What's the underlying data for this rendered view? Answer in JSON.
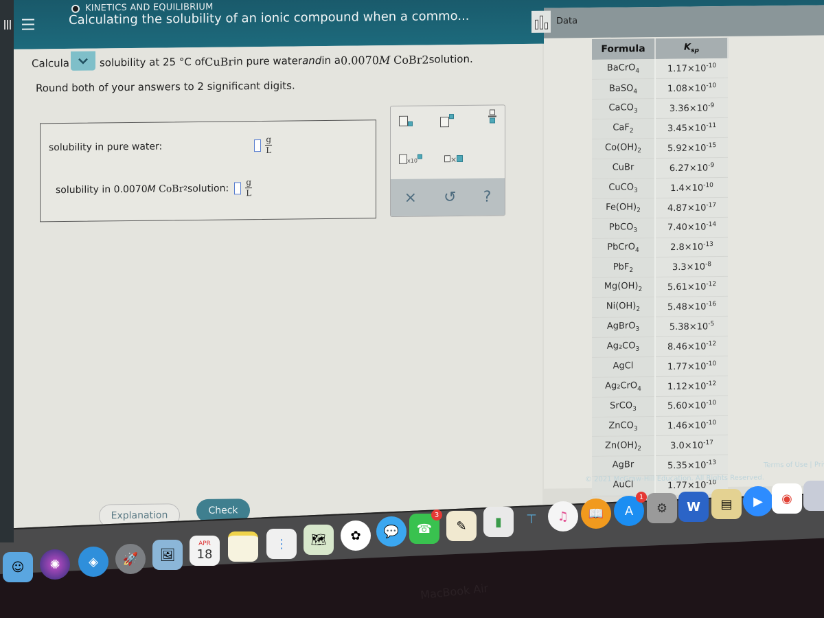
{
  "header": {
    "topic": "KINETICS AND EQUILIBRIUM",
    "title": "Calculating the solubility of an ionic compound when a commo..."
  },
  "question": {
    "prefix": "Calcula",
    "text_part1": "solubility at 25 °C of ",
    "compound": "CuBr",
    "text_part2": " in pure water ",
    "and_word": "and",
    "text_part3": " in a ",
    "concentration": "0.0070",
    "unit": "M",
    "solute": "CoBr",
    "solute_sub": "2",
    "text_part4": " solution.",
    "instruction": "Round both of your answers to 2 significant digits."
  },
  "answers": [
    {
      "label": "solubility in pure water:",
      "value": "",
      "unit_num": "g",
      "unit_den": "L"
    },
    {
      "label_pre": "solubility in 0.0070 ",
      "label_unit": "M",
      "label_solute": "CoBr",
      "label_sub": "2",
      "label_post": " solution:",
      "value": "",
      "unit_num": "g",
      "unit_den": "L"
    }
  ],
  "palette": {
    "buttons": [
      "subscript",
      "superscript",
      "fraction",
      "scientific-notation",
      "multiplication"
    ],
    "x10_label": "x10",
    "times_label": "×",
    "actions": {
      "clear": "×",
      "undo": "↺",
      "help": "?"
    }
  },
  "buttons": {
    "explanation": "Explanation",
    "check": "Check"
  },
  "data_panel": {
    "label": "Data",
    "headers": {
      "formula": "Formula",
      "ksp": "K",
      "ksp_sub": "sp"
    },
    "rows": [
      {
        "f": "BaCrO",
        "fs": "4",
        "m": "1.17",
        "e": "-10"
      },
      {
        "f": "BaSO",
        "fs": "4",
        "m": "1.08",
        "e": "-10"
      },
      {
        "f": "CaCO",
        "fs": "3",
        "m": "3.36",
        "e": "-9"
      },
      {
        "f": "CaF",
        "fs": "2",
        "m": "3.45",
        "e": "-11"
      },
      {
        "f": "Co(OH)",
        "fs": "2",
        "m": "5.92",
        "e": "-15"
      },
      {
        "f": "CuBr",
        "fs": "",
        "m": "6.27",
        "e": "-9"
      },
      {
        "f": "CuCO",
        "fs": "3",
        "m": "1.4",
        "e": "-10"
      },
      {
        "f": "Fe(OH)",
        "fs": "2",
        "m": "4.87",
        "e": "-17"
      },
      {
        "f": "PbCO",
        "fs": "3",
        "m": "7.40",
        "e": "-14"
      },
      {
        "f": "PbCrO",
        "fs": "4",
        "m": "2.8",
        "e": "-13"
      },
      {
        "f": "PbF",
        "fs": "2",
        "m": "3.3",
        "e": "-8"
      },
      {
        "f": "Mg(OH)",
        "fs": "2",
        "m": "5.61",
        "e": "-12"
      },
      {
        "f": "Ni(OH)",
        "fs": "2",
        "m": "5.48",
        "e": "-16"
      },
      {
        "f": "AgBrO",
        "fs": "3",
        "m": "5.38",
        "e": "-5"
      },
      {
        "f": "Ag₂CO",
        "fs": "3",
        "m": "8.46",
        "e": "-12"
      },
      {
        "f": "AgCl",
        "fs": "",
        "m": "1.77",
        "e": "-10"
      },
      {
        "f": "Ag₂CrO",
        "fs": "4",
        "m": "1.12",
        "e": "-12"
      },
      {
        "f": "SrCO",
        "fs": "3",
        "m": "5.60",
        "e": "-10"
      },
      {
        "f": "ZnCO",
        "fs": "3",
        "m": "1.46",
        "e": "-10"
      },
      {
        "f": "Zn(OH)",
        "fs": "2",
        "m": "3.0",
        "e": "-17"
      },
      {
        "f": "AgBr",
        "fs": "",
        "m": "5.35",
        "e": "-13"
      },
      {
        "f": "AuCl",
        "fs": "",
        "m": "1.77",
        "e": "-10"
      }
    ],
    "copyright": "© 2021 McGraw-Hill Education. All Rights Reserved.",
    "terms": "Terms of Use  |  Priv"
  },
  "dock": {
    "calendar_month": "APR",
    "calendar_day": "18",
    "facetime_badge": "3",
    "appstore_badge": "1",
    "word_letter": "W"
  },
  "device_label": "MacBook Air"
}
